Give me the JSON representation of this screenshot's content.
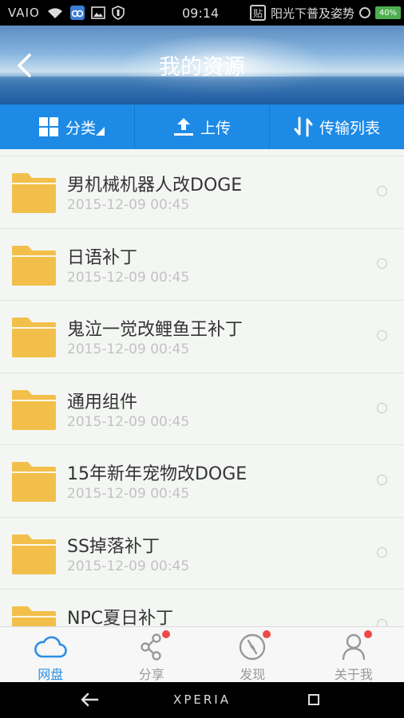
{
  "status_bar": {
    "brand": "VAIO",
    "time": "09:14",
    "notification_badge": "贴",
    "notification_text": "阳光下普及姿势",
    "battery": "40%"
  },
  "header": {
    "title": "我的资源"
  },
  "toolbar": {
    "category_label": "分类",
    "upload_label": "上传",
    "transfer_label": "传输列表"
  },
  "files": [
    {
      "name": "男机械机器人改DOGE",
      "date": "2015-12-09  00:45"
    },
    {
      "name": "日语补丁",
      "date": "2015-12-09  00:45"
    },
    {
      "name": "鬼泣一觉改鲤鱼王补丁",
      "date": "2015-12-09  00:45"
    },
    {
      "name": "通用组件",
      "date": "2015-12-09  00:45"
    },
    {
      "name": "15年新年宠物改DOGE",
      "date": "2015-12-09  00:45"
    },
    {
      "name": "SS掉落补丁",
      "date": "2015-12-09  00:45"
    },
    {
      "name": "NPC夏日补丁",
      "date": ""
    }
  ],
  "bottom_nav": {
    "items": [
      {
        "label": "网盘",
        "icon": "cloud-icon",
        "active": true
      },
      {
        "label": "分享",
        "icon": "share-icon",
        "badge": true
      },
      {
        "label": "发现",
        "icon": "compass-icon",
        "badge": true
      },
      {
        "label": "关于我",
        "icon": "person-icon",
        "badge": true
      }
    ]
  },
  "system_nav": {
    "brand": "XPERIA"
  },
  "colors": {
    "accent": "#1d8ae6",
    "folder": "#f2c04a",
    "badge_red": "#f04848"
  }
}
